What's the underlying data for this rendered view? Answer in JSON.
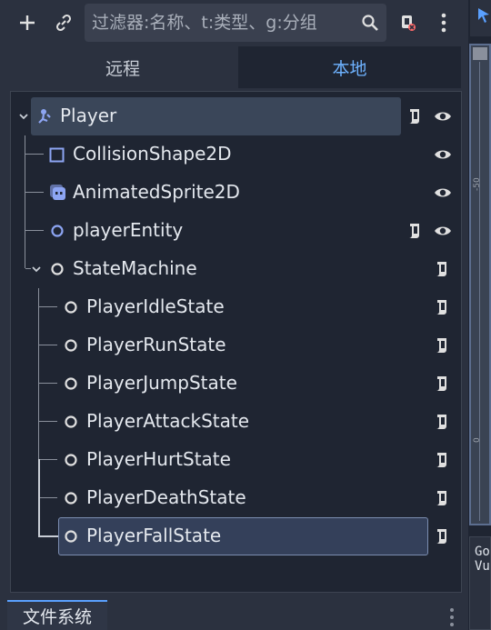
{
  "toolbar": {
    "filter_placeholder": "过滤器:名称、t:类型、g:分组",
    "add_icon": "plus-icon",
    "link_icon": "link-icon",
    "search_icon": "search-icon",
    "script_filter_icon": "script-filter-icon",
    "menu_icon": "kebab-menu-icon"
  },
  "tabs": {
    "remote": "远程",
    "local": "本地"
  },
  "tree": {
    "nodes": [
      {
        "label": "Player",
        "icon": "character-body-icon",
        "script": true,
        "visible": true
      },
      {
        "label": "CollisionShape2D",
        "icon": "collision-shape-icon",
        "script": false,
        "visible": true
      },
      {
        "label": "AnimatedSprite2D",
        "icon": "animated-sprite-icon",
        "script": false,
        "visible": true
      },
      {
        "label": "playerEntity",
        "icon": "node-icon",
        "script": true,
        "visible": true
      },
      {
        "label": "StateMachine",
        "icon": "node-icon",
        "script": true,
        "visible": false
      },
      {
        "label": "PlayerIdleState",
        "icon": "node-icon",
        "script": true,
        "visible": false
      },
      {
        "label": "PlayerRunState",
        "icon": "node-icon",
        "script": true,
        "visible": false
      },
      {
        "label": "PlayerJumpState",
        "icon": "node-icon",
        "script": true,
        "visible": false
      },
      {
        "label": "PlayerAttackState",
        "icon": "node-icon",
        "script": true,
        "visible": false
      },
      {
        "label": "PlayerHurtState",
        "icon": "node-icon",
        "script": true,
        "visible": false
      },
      {
        "label": "PlayerDeathState",
        "icon": "node-icon",
        "script": true,
        "visible": false
      },
      {
        "label": "PlayerFallState",
        "icon": "node-icon",
        "script": true,
        "visible": false
      }
    ]
  },
  "viewport_ruler": {
    "mark_a": "-50",
    "mark_b": "0"
  },
  "output_snippet": {
    "line1": "Go",
    "line2": "Vu"
  },
  "bottom_tab": {
    "label": "文件系统"
  },
  "colors": {
    "accent": "#6eb2ff",
    "node_blue": "#8da5f3",
    "panel": "#1f2532"
  }
}
